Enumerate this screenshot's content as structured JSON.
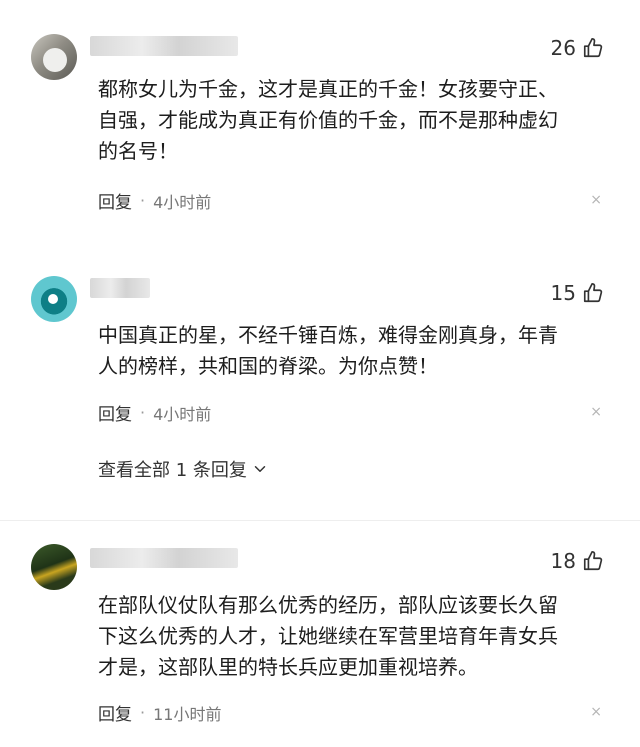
{
  "comments": [
    {
      "likes": "26",
      "text_lines": [
        "都称女儿为千金，这才是真正的千金！女孩要守正、",
        "自强，才能成为真正有价值的千金，而不是那种虚幻",
        "的名号！"
      ],
      "reply_label": "回复",
      "separator": "·",
      "time": "4小时前",
      "close_glyph": "×"
    },
    {
      "likes": "15",
      "text_lines": [
        "中国真正的星，不经千锤百炼，难得金刚真身，年青",
        "人的榜样，共和国的脊梁。为你点赞！"
      ],
      "reply_label": "回复",
      "separator": "·",
      "time": "4小时前",
      "close_glyph": "×",
      "view_replies": "查看全部 1 条回复"
    },
    {
      "likes": "18",
      "text_lines": [
        "在部队仪仗队有那么优秀的经历，部队应该要长久留",
        "下这么优秀的人才，让她继续在军营里培育年青女兵",
        "才是，这部队里的特长兵应更加重视培养。"
      ],
      "reply_label": "回复",
      "separator": "·",
      "time": "11小时前",
      "close_glyph": "×"
    }
  ],
  "icons": {
    "like": "thumbs-up-icon",
    "chevron": "chevron-down-icon",
    "close": "close-icon"
  },
  "colors": {
    "text": "#1d1d1d",
    "meta": "#777777",
    "close": "#b5b5b5"
  }
}
